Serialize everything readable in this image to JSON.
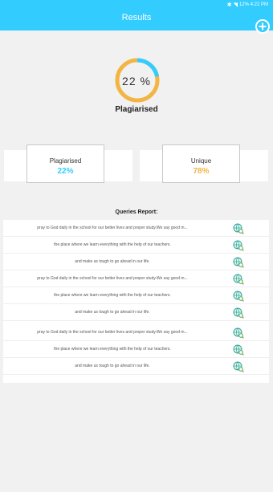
{
  "status_bar": {
    "icons": [
      "bluetooth-icon",
      "wifi-icon",
      "battery-icon"
    ],
    "text": "12% 4:22 PM"
  },
  "appbar": {
    "title": "Results",
    "add_button_icon": "plus-icon"
  },
  "result": {
    "percent_text": "22 %",
    "percent_value": 22,
    "caption": "Plagiarised",
    "ring_color": "#f2b544",
    "fill_color": "#33ccff"
  },
  "cards": {
    "plagiarised": {
      "label": "Plagiarised",
      "value": "22%",
      "color": "#33ccff"
    },
    "unique": {
      "label": "Unique",
      "value": "78%",
      "color": "#f2b544"
    }
  },
  "queries": {
    "title": "Queries Report:",
    "rows": [
      "pray to God daily in the school for our better lives and proper study.We say good m...",
      "the place where we learn everything with the help of our teachers.",
      "and make us tough to go ahead in our life.",
      "pray to God daily in the school for our better lives and proper study.We say good m...",
      "the place where we learn everything with the help of our teachers.",
      "and make us tough to go ahead in our life.",
      "pray to God daily in the school for our better lives and proper study.We say good m...",
      "the place where we learn everything with the help of our teachers.",
      "and make us tough to go ahead in our life."
    ],
    "row_icon": "globe-search-icon"
  }
}
